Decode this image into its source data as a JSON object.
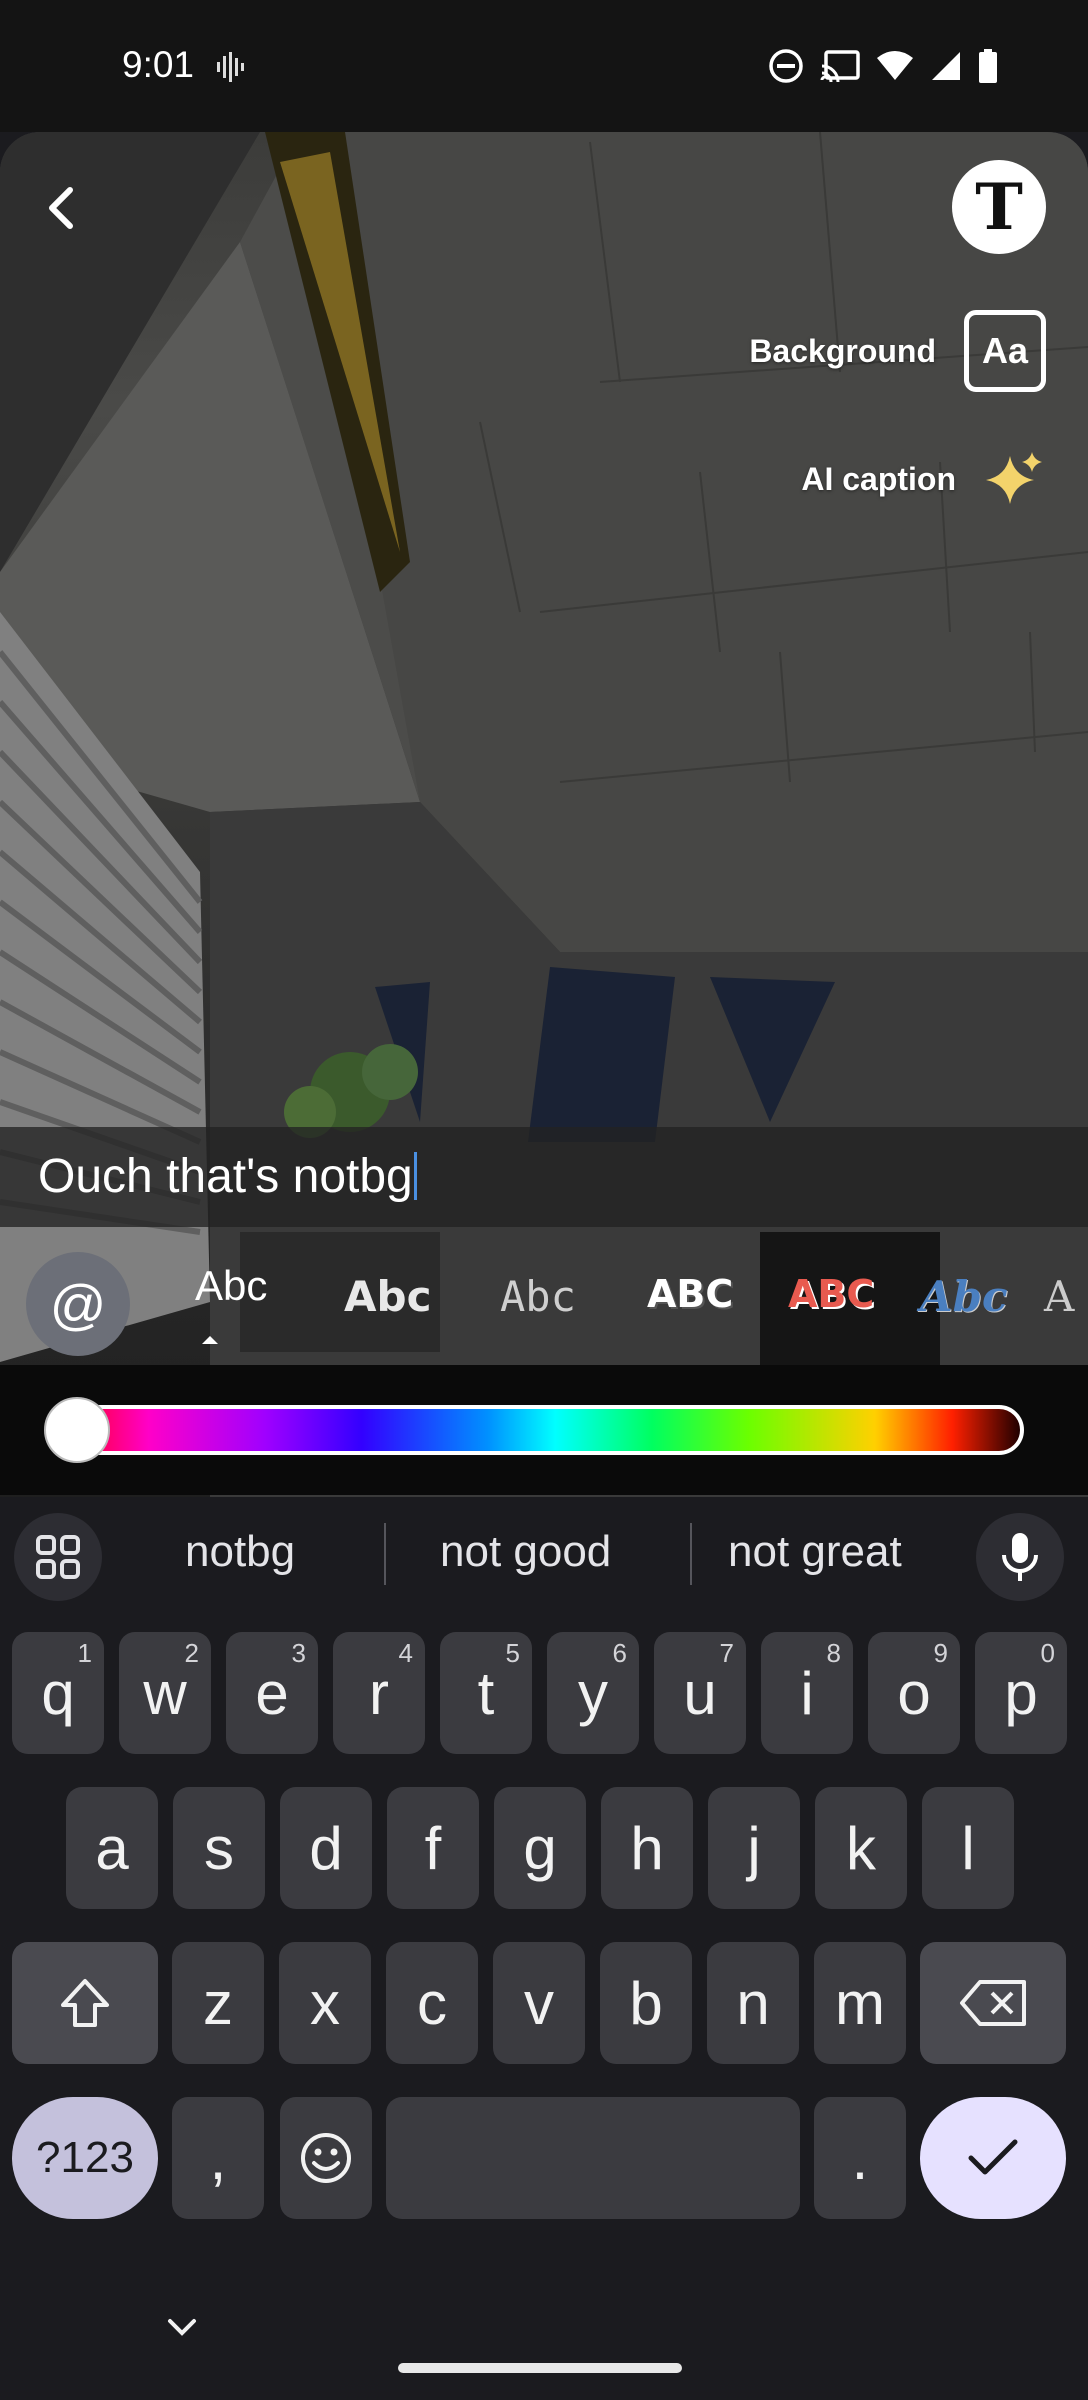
{
  "status_bar": {
    "time": "9:01",
    "icons": [
      "sound-wave-icon",
      "do-not-disturb-icon",
      "cast-icon",
      "wifi-icon",
      "signal-icon",
      "battery-icon"
    ]
  },
  "editor": {
    "back_icon": "chevron-left-icon",
    "text_tool_glyph": "T",
    "background_label": "Background",
    "background_icon_text": "Aa",
    "ai_caption_label": "AI caption",
    "ai_caption_icon": "sparkle-icon",
    "caption_text": "Ouch that's notbg",
    "mention_glyph": "@",
    "font_styles": [
      "Abc",
      "Abc",
      "Abc",
      "ABC",
      "ABC",
      "Abc",
      "A"
    ],
    "selected_font_index": 0,
    "color_slider_value": 0
  },
  "keyboard": {
    "suggestions": [
      "notbg",
      "not good",
      "not great"
    ],
    "row1": [
      {
        "k": "q",
        "n": "1"
      },
      {
        "k": "w",
        "n": "2"
      },
      {
        "k": "e",
        "n": "3"
      },
      {
        "k": "r",
        "n": "4"
      },
      {
        "k": "t",
        "n": "5"
      },
      {
        "k": "y",
        "n": "6"
      },
      {
        "k": "u",
        "n": "7"
      },
      {
        "k": "i",
        "n": "8"
      },
      {
        "k": "o",
        "n": "9"
      },
      {
        "k": "p",
        "n": "0"
      }
    ],
    "row2": [
      "a",
      "s",
      "d",
      "f",
      "g",
      "h",
      "j",
      "k",
      "l"
    ],
    "row3": [
      "z",
      "x",
      "c",
      "v",
      "b",
      "n",
      "m"
    ],
    "symbols_label": "?123",
    "comma": ",",
    "period": ".",
    "accent_color": "#e6e1ff"
  }
}
